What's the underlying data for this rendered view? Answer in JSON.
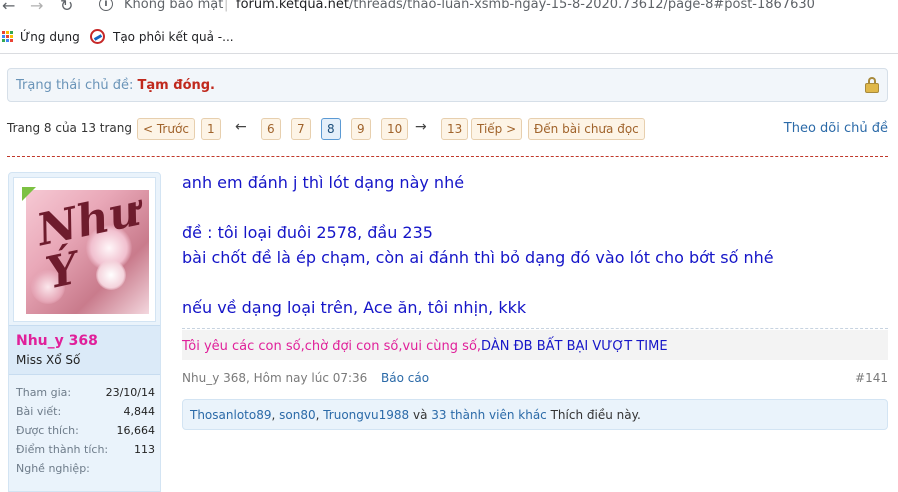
{
  "browser": {
    "not_secure_label": "Không bảo mật",
    "url_separator": "|",
    "url_host": "forum.ketqua.net",
    "url_path": "/threads/thao-luan-xsmb-ngay-15-8-2020.73612/page-8#post-1867630",
    "bookmarks": [
      {
        "label": "Ứng dụng",
        "icon": "apps-grid-icon"
      },
      {
        "label": "Tạo phôi kết quả -...",
        "icon": "ketqua-favicon"
      }
    ]
  },
  "thread_status": {
    "label": "Trạng thái chủ đề:",
    "value": "Tạm đóng.",
    "icon": "lock-icon"
  },
  "pagination": {
    "info": "Trang 8 của 13 trang",
    "prev": "< Trước",
    "first": "1",
    "left_arrow": "←",
    "pages": [
      "6",
      "7",
      "8",
      "9",
      "10"
    ],
    "current": "8",
    "right_arrow": "→",
    "last": "13",
    "next": "Tiếp >",
    "unread": "Đến bài chưa đọc",
    "follow": "Theo dõi chủ đề"
  },
  "user": {
    "avatar_text": "Như Ý",
    "username": "Nhu_y 368",
    "title": "Miss Xổ Số",
    "stats": [
      {
        "label": "Tham gia:",
        "value": "23/10/14"
      },
      {
        "label": "Bài viết:",
        "value": "4,844"
      },
      {
        "label": "Được thích:",
        "value": "16,664"
      },
      {
        "label": "Điểm thành tích:",
        "value": "113"
      },
      {
        "label": "Nghề nghiệp:",
        "value": ""
      }
    ]
  },
  "post": {
    "lines": [
      "anh em đánh j thì lót dạng này nhé",
      "đề : tôi loại đuôi 2578, đầu 235",
      "bài chốt đề là ép chạm, còn ai đánh thì bỏ dạng đó vào lót cho bớt số nhé",
      "nếu về dạng loại trên, Ace ăn, tôi nhịn, kkk"
    ],
    "signature_pink": "Tôi yêu các con số,chờ đợi con số,vui cùng số,",
    "signature_blue": "DÀN ĐB BẤT BẠI VƯỢT TIME",
    "meta_author": "Nhu_y 368, Hôm nay lúc 07:36",
    "report": "Báo cáo",
    "post_number": "#141",
    "likes": {
      "users": [
        "Thosanloto89",
        "son80",
        "Truongvu1988"
      ],
      "sep1": ", ",
      "sep2": ", ",
      "and": " và ",
      "others": "33 thành viên khác",
      "suffix": " Thích điều này."
    }
  },
  "colors": {
    "status_value": "#c0291d",
    "post_text": "#1515c8",
    "username": "#e0209a",
    "link": "#2b6aa8"
  }
}
